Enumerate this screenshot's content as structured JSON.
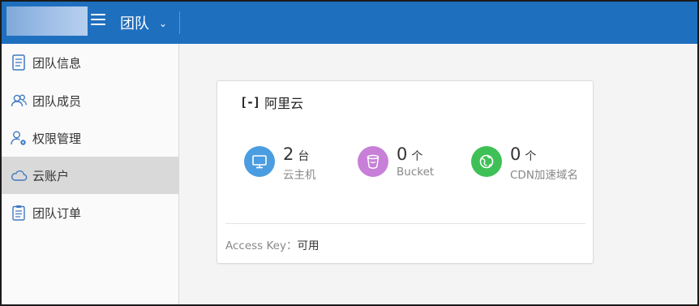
{
  "topbar": {
    "team_title": "团队",
    "colors": {
      "bar": "#1f6fbf"
    }
  },
  "sidebar": {
    "items": [
      {
        "label": "团队信息",
        "icon": "document-icon",
        "active": false
      },
      {
        "label": "团队成员",
        "icon": "users-icon",
        "active": false
      },
      {
        "label": "权限管理",
        "icon": "user-settings-icon",
        "active": false
      },
      {
        "label": "云账户",
        "icon": "cloud-icon",
        "active": true
      },
      {
        "label": "团队订单",
        "icon": "clipboard-icon",
        "active": false
      }
    ]
  },
  "card": {
    "brand": {
      "mark": "[-]",
      "name": "阿里云"
    },
    "stats": [
      {
        "value": "2",
        "unit": "台",
        "label": "云主机",
        "icon": "monitor-icon",
        "color": "#4a9de0"
      },
      {
        "value": "0",
        "unit": "个",
        "label": "Bucket",
        "icon": "bucket-icon",
        "color": "#c77fd8"
      },
      {
        "value": "0",
        "unit": "个",
        "label": "CDN加速域名",
        "icon": "globe-icon",
        "color": "#3fc057"
      }
    ],
    "access_key_label": "Access Key：",
    "access_key_value": "可用"
  }
}
